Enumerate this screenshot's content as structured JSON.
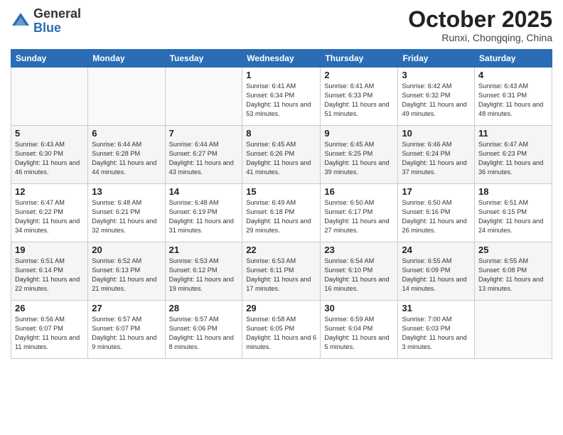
{
  "header": {
    "logo_general": "General",
    "logo_blue": "Blue",
    "month": "October 2025",
    "location": "Runxi, Chongqing, China"
  },
  "weekdays": [
    "Sunday",
    "Monday",
    "Tuesday",
    "Wednesday",
    "Thursday",
    "Friday",
    "Saturday"
  ],
  "weeks": [
    [
      {
        "day": "",
        "info": ""
      },
      {
        "day": "",
        "info": ""
      },
      {
        "day": "",
        "info": ""
      },
      {
        "day": "1",
        "info": "Sunrise: 6:41 AM\nSunset: 6:34 PM\nDaylight: 11 hours and 53 minutes."
      },
      {
        "day": "2",
        "info": "Sunrise: 6:41 AM\nSunset: 6:33 PM\nDaylight: 11 hours and 51 minutes."
      },
      {
        "day": "3",
        "info": "Sunrise: 6:42 AM\nSunset: 6:32 PM\nDaylight: 11 hours and 49 minutes."
      },
      {
        "day": "4",
        "info": "Sunrise: 6:43 AM\nSunset: 6:31 PM\nDaylight: 11 hours and 48 minutes."
      }
    ],
    [
      {
        "day": "5",
        "info": "Sunrise: 6:43 AM\nSunset: 6:30 PM\nDaylight: 11 hours and 46 minutes."
      },
      {
        "day": "6",
        "info": "Sunrise: 6:44 AM\nSunset: 6:28 PM\nDaylight: 11 hours and 44 minutes."
      },
      {
        "day": "7",
        "info": "Sunrise: 6:44 AM\nSunset: 6:27 PM\nDaylight: 11 hours and 43 minutes."
      },
      {
        "day": "8",
        "info": "Sunrise: 6:45 AM\nSunset: 6:26 PM\nDaylight: 11 hours and 41 minutes."
      },
      {
        "day": "9",
        "info": "Sunrise: 6:45 AM\nSunset: 6:25 PM\nDaylight: 11 hours and 39 minutes."
      },
      {
        "day": "10",
        "info": "Sunrise: 6:46 AM\nSunset: 6:24 PM\nDaylight: 11 hours and 37 minutes."
      },
      {
        "day": "11",
        "info": "Sunrise: 6:47 AM\nSunset: 6:23 PM\nDaylight: 11 hours and 36 minutes."
      }
    ],
    [
      {
        "day": "12",
        "info": "Sunrise: 6:47 AM\nSunset: 6:22 PM\nDaylight: 11 hours and 34 minutes."
      },
      {
        "day": "13",
        "info": "Sunrise: 6:48 AM\nSunset: 6:21 PM\nDaylight: 11 hours and 32 minutes."
      },
      {
        "day": "14",
        "info": "Sunrise: 6:48 AM\nSunset: 6:19 PM\nDaylight: 11 hours and 31 minutes."
      },
      {
        "day": "15",
        "info": "Sunrise: 6:49 AM\nSunset: 6:18 PM\nDaylight: 11 hours and 29 minutes."
      },
      {
        "day": "16",
        "info": "Sunrise: 6:50 AM\nSunset: 6:17 PM\nDaylight: 11 hours and 27 minutes."
      },
      {
        "day": "17",
        "info": "Sunrise: 6:50 AM\nSunset: 6:16 PM\nDaylight: 11 hours and 26 minutes."
      },
      {
        "day": "18",
        "info": "Sunrise: 6:51 AM\nSunset: 6:15 PM\nDaylight: 11 hours and 24 minutes."
      }
    ],
    [
      {
        "day": "19",
        "info": "Sunrise: 6:51 AM\nSunset: 6:14 PM\nDaylight: 11 hours and 22 minutes."
      },
      {
        "day": "20",
        "info": "Sunrise: 6:52 AM\nSunset: 6:13 PM\nDaylight: 11 hours and 21 minutes."
      },
      {
        "day": "21",
        "info": "Sunrise: 6:53 AM\nSunset: 6:12 PM\nDaylight: 11 hours and 19 minutes."
      },
      {
        "day": "22",
        "info": "Sunrise: 6:53 AM\nSunset: 6:11 PM\nDaylight: 11 hours and 17 minutes."
      },
      {
        "day": "23",
        "info": "Sunrise: 6:54 AM\nSunset: 6:10 PM\nDaylight: 11 hours and 16 minutes."
      },
      {
        "day": "24",
        "info": "Sunrise: 6:55 AM\nSunset: 6:09 PM\nDaylight: 11 hours and 14 minutes."
      },
      {
        "day": "25",
        "info": "Sunrise: 6:55 AM\nSunset: 6:08 PM\nDaylight: 11 hours and 13 minutes."
      }
    ],
    [
      {
        "day": "26",
        "info": "Sunrise: 6:56 AM\nSunset: 6:07 PM\nDaylight: 11 hours and 11 minutes."
      },
      {
        "day": "27",
        "info": "Sunrise: 6:57 AM\nSunset: 6:07 PM\nDaylight: 11 hours and 9 minutes."
      },
      {
        "day": "28",
        "info": "Sunrise: 6:57 AM\nSunset: 6:06 PM\nDaylight: 11 hours and 8 minutes."
      },
      {
        "day": "29",
        "info": "Sunrise: 6:58 AM\nSunset: 6:05 PM\nDaylight: 11 hours and 6 minutes."
      },
      {
        "day": "30",
        "info": "Sunrise: 6:59 AM\nSunset: 6:04 PM\nDaylight: 11 hours and 5 minutes."
      },
      {
        "day": "31",
        "info": "Sunrise: 7:00 AM\nSunset: 6:03 PM\nDaylight: 11 hours and 3 minutes."
      },
      {
        "day": "",
        "info": ""
      }
    ]
  ]
}
